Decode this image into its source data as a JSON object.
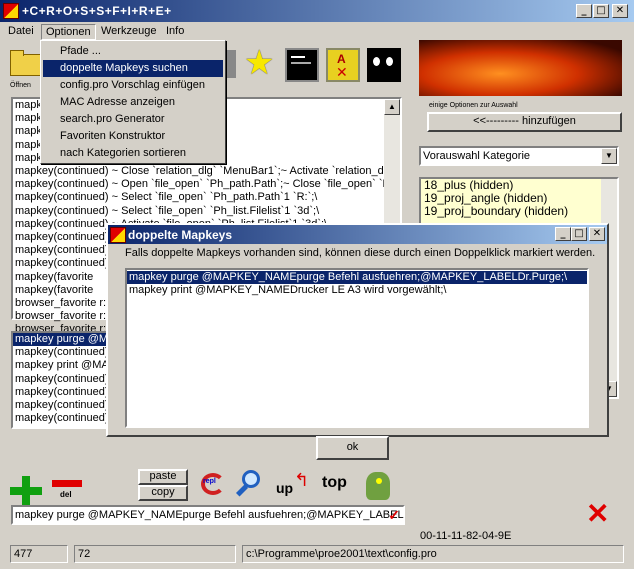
{
  "window": {
    "title": "+C+R+O+S+S+F+I+R+E+",
    "minimize": "_",
    "maximize": "□",
    "close": "✕"
  },
  "menubar": {
    "items": [
      "Datei",
      "Optionen",
      "Werkzeuge",
      "Info"
    ]
  },
  "dropdown": {
    "items": [
      "Pfade ...",
      "doppelte Mapkeys suchen",
      "config.pro Vorschlag einfügen",
      "MAC Adresse anzeigen",
      "search.pro Generator",
      "Favoriten Konstruktor",
      "nach Kategorien sortieren"
    ]
  },
  "toolbar": {
    "open_label": "Öffnen"
  },
  "left_list": {
    "lines": [
      "mapk                                    list.Filelist`1 `parameter_pwk.txt`;\\",
      "mapk                                    pen`;\\",
      "mapk                                    ehungen ohne Parameter einsetze",
      "mapk                                    sch !;@MAPKEY_LABELBeziehu",
      "mapk                                    enuBar1`1 `File`;\\",
      "mapkey(continued) ~ Close `relation_dlg` `MenuBar1`;~ Activate `relation_dlg` `",
      "mapkey(continued) ~ Open `file_open` `Ph_path.Path`;~ Close `file_open` `Ph_",
      "mapkey(continued) ~ Select `file_open` `Ph_path.Path`1 `R:`;\\",
      "mapkey(continued) ~ Select `file_open` `Ph_list.Filelist`1 `3d`;\\",
      "mapkey(continued) ~ Activate `file_open` `Ph_list.Filelist`1 `3d`;\\",
      "mapkey(continued)",
      "mapkey(continued)",
      "mapkey(continued)",
      "mapkey(favorite",
      "mapkey(favorite",
      "browser_favorite r:",
      "browser_favorite r:",
      "browser_favorite r:"
    ],
    "lower_lines": [
      "mapkey purge @MA",
      "mapkey(continued)",
      "mapkey print @MA",
      "mapkey(continued)",
      "mapkey(continued)",
      "mapkey(continued)",
      "mapkey(continued)"
    ]
  },
  "right_panel": {
    "options_caption": "einige Optionen zur Auswahl",
    "add_button": "<<--------- hinzufügen",
    "category_select": "Vorauswahl Kategorie",
    "list": [
      "18_plus (hidden)",
      "19_proj_angle (hidden)",
      "19_proj_boundary (hidden)"
    ]
  },
  "dialog": {
    "title": "doppelte Mapkeys",
    "message": "Falls doppelte Mapkeys vorhanden sind, können diese durch einen Doppelklick markiert werden.",
    "items": [
      "mapkey purge @MAPKEY_NAMEpurge Befehl ausfuehren;@MAPKEY_LABELDr.Purge;\\",
      "mapkey print @MAPKEY_NAMEDrucker LE A3 wird vorgewählt;\\"
    ],
    "ok": "ok"
  },
  "bottom": {
    "paste": "paste",
    "copy": "copy",
    "del": "del",
    "repl": "repl",
    "up": "up",
    "top": "top",
    "input_value": "mapkey purge @MAPKEY_NAMEpurge Befehl ausfuehren;@MAPKEY_LABEL",
    "mac": "00-11-11-82-04-9E"
  },
  "status": {
    "line": "477",
    "col": "72",
    "path": "c:\\Programme\\proe2001\\text\\config.pro"
  },
  "colors": {
    "title_blue": "#0a246a",
    "selection": "#0a246a",
    "right_list_bg": "#ffffd0",
    "plus_green": "#10a010",
    "minus_red": "#e00000"
  }
}
